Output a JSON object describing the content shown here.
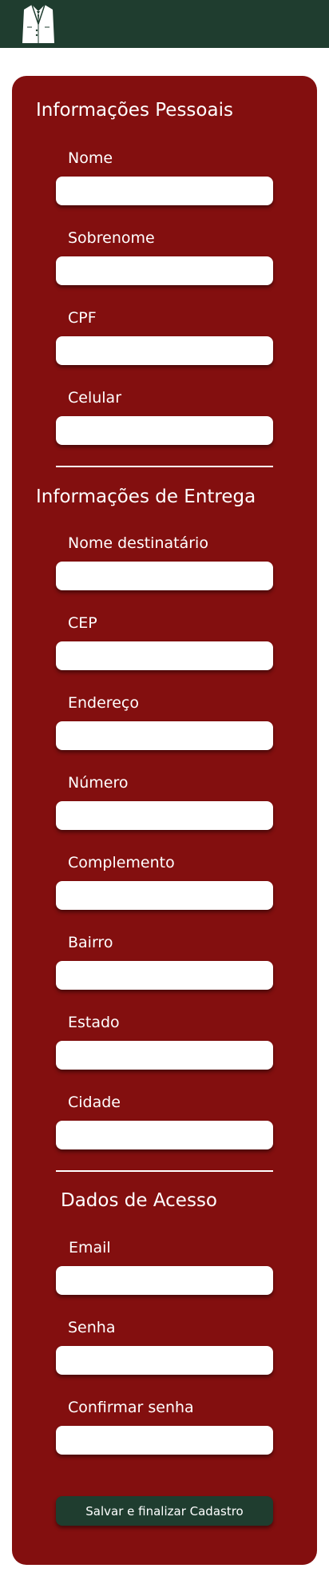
{
  "header": {
    "logo_icon": "suit-jacket-icon",
    "background": "#1f3d2f"
  },
  "form": {
    "background": "#830f0f",
    "personal": {
      "title": "Informações Pessoais",
      "fields": [
        "Nome",
        "Sobrenome",
        "CPF",
        "Celular"
      ]
    },
    "delivery": {
      "title": "Informações de Entrega",
      "fields": [
        "Nome destinatário",
        "CEP",
        "Endereço",
        "Número",
        "Complemento",
        "Bairro",
        "Estado",
        "Cidade"
      ]
    },
    "access": {
      "title": "Dados de Acesso",
      "fields": [
        "Email",
        "Senha",
        "Confirmar senha"
      ]
    },
    "submit_label": "Salvar e finalizar Cadastro",
    "submit_color": "#1f3d2f"
  }
}
